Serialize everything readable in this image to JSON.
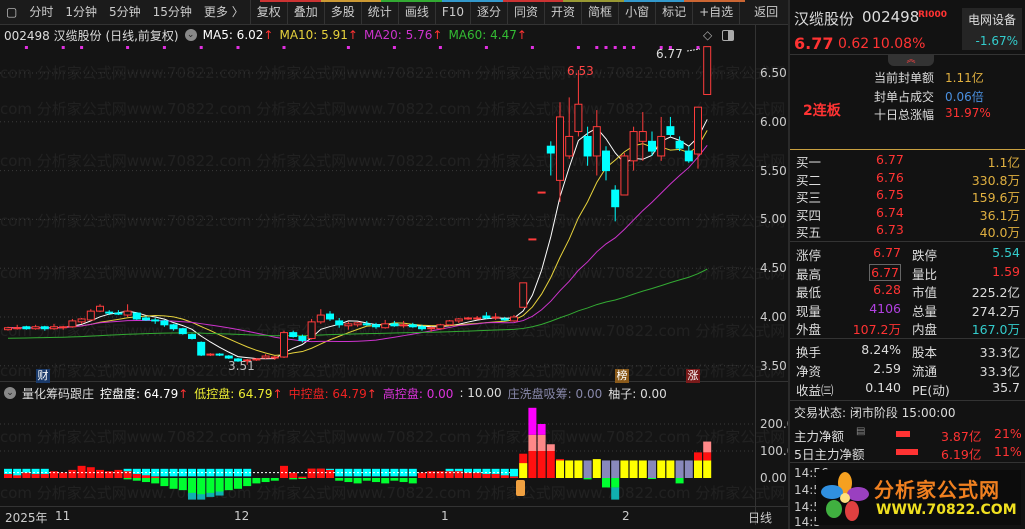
{
  "toolbar": {
    "items": [
      "分时",
      "1分钟",
      "5分钟",
      "15分钟",
      "更多 〉"
    ],
    "buttons": [
      "复权",
      "叠加",
      "多股",
      "统计",
      "画线",
      "F10",
      "逐分",
      "同资",
      "开资",
      "简框",
      "小窗",
      "标记",
      "+自选",
      "返回"
    ]
  },
  "info": {
    "title": "002498 汉缆股份 (日线,前复权)",
    "ma5": "MA5: 6.02",
    "ma10": "MA10: 5.91",
    "ma20": "MA20: 5.76",
    "ma60": "MA60: 4.47",
    "arrow": "↑"
  },
  "colors": {
    "up": "#ff3c3c",
    "down": "#00ffff",
    "ma5": "#ffffff",
    "ma10": "#e6d23c",
    "ma20": "#cc33cc",
    "ma60": "#33aa33"
  },
  "price_axis": [
    "6.50",
    "6.00",
    "5.50",
    "5.00",
    "4.50",
    "4.00",
    "3.50"
  ],
  "ind_axis": [
    "200.0",
    "100.0",
    "0.00"
  ],
  "annotations": {
    "high": "6.53",
    "last": "6.77",
    "low": "3.51",
    "cai": "财",
    "bang": "榜",
    "zhang": "涨"
  },
  "indicator": {
    "name": "量化筹码跟庄",
    "kpd": "控盘度: 64.79",
    "dkp": "低控盘: 64.79",
    "zkp": "中控盘: 64.79",
    "gkp": "高控盘: 0.00",
    "ten": ": 10.00",
    "zx": "庄洗盘吸筹: 0.00",
    "yz": "柚子: 0.00",
    "arrow": "↑"
  },
  "xaxis": {
    "year": "2025年",
    "m11": "11",
    "m12": "12",
    "m1": "1",
    "m2": "2",
    "period": "日线"
  },
  "watermark": "com 分析家公式网www.70822.com 分析家公式网www.70822.com 分析家公式网www.70822.com 分析家公式网",
  "chart_data": {
    "type": "candlestick",
    "ylim": [
      3.5,
      6.77
    ],
    "ohlc": [
      [
        3.87,
        3.9,
        3.86,
        3.89
      ],
      [
        3.88,
        3.92,
        3.87,
        3.89
      ],
      [
        3.9,
        3.91,
        3.87,
        3.88
      ],
      [
        3.88,
        3.92,
        3.87,
        3.9
      ],
      [
        3.9,
        3.91,
        3.86,
        3.88
      ],
      [
        3.88,
        3.93,
        3.87,
        3.9
      ],
      [
        3.89,
        3.91,
        3.87,
        3.9
      ],
      [
        3.9,
        3.98,
        3.89,
        3.96
      ],
      [
        3.95,
        3.99,
        3.93,
        3.98
      ],
      [
        3.97,
        4.08,
        3.96,
        4.06
      ],
      [
        4.06,
        4.13,
        4.05,
        4.11
      ],
      [
        4.05,
        4.07,
        4.02,
        4.04
      ],
      [
        4.04,
        4.07,
        4.02,
        4.03
      ],
      [
        4.02,
        4.13,
        4.0,
        4.06
      ],
      [
        4.04,
        4.05,
        3.97,
        3.98
      ],
      [
        3.99,
        4.01,
        3.96,
        3.97
      ],
      [
        3.97,
        3.99,
        3.93,
        3.96
      ],
      [
        3.96,
        3.97,
        3.9,
        3.92
      ],
      [
        3.92,
        3.93,
        3.86,
        3.88
      ],
      [
        3.88,
        3.89,
        3.82,
        3.83
      ],
      [
        3.82,
        3.83,
        3.77,
        3.78
      ],
      [
        3.74,
        3.75,
        3.6,
        3.61
      ],
      [
        3.61,
        3.63,
        3.6,
        3.62
      ],
      [
        3.62,
        3.63,
        3.6,
        3.61
      ],
      [
        3.6,
        3.61,
        3.57,
        3.58
      ],
      [
        3.57,
        3.58,
        3.54,
        3.55
      ],
      [
        3.55,
        3.57,
        3.51,
        3.56
      ],
      [
        3.56,
        3.58,
        3.55,
        3.57
      ],
      [
        3.58,
        3.62,
        3.57,
        3.6
      ],
      [
        3.58,
        3.6,
        3.56,
        3.59
      ],
      [
        3.59,
        3.86,
        3.58,
        3.84
      ],
      [
        3.84,
        3.86,
        3.79,
        3.8
      ],
      [
        3.8,
        3.82,
        3.74,
        3.76
      ],
      [
        3.78,
        3.98,
        3.77,
        3.95
      ],
      [
        3.95,
        4.08,
        3.93,
        4.02
      ],
      [
        4.03,
        4.06,
        3.96,
        3.98
      ],
      [
        3.96,
        3.99,
        3.89,
        3.92
      ],
      [
        3.91,
        3.95,
        3.87,
        3.93
      ],
      [
        3.92,
        3.95,
        3.9,
        3.94
      ],
      [
        3.93,
        3.96,
        3.91,
        3.92
      ],
      [
        3.92,
        3.94,
        3.88,
        3.9
      ],
      [
        3.89,
        3.97,
        3.88,
        3.93
      ],
      [
        3.93,
        3.96,
        3.9,
        3.91
      ],
      [
        3.91,
        3.96,
        3.89,
        3.92
      ],
      [
        3.92,
        3.94,
        3.89,
        3.9
      ],
      [
        3.9,
        3.92,
        3.86,
        3.88
      ],
      [
        3.88,
        3.9,
        3.85,
        3.89
      ],
      [
        3.88,
        3.93,
        3.87,
        3.92
      ],
      [
        3.92,
        3.97,
        3.91,
        3.96
      ],
      [
        3.96,
        3.99,
        3.94,
        3.98
      ],
      [
        3.98,
        4.0,
        3.97,
        3.99
      ],
      [
        3.99,
        4.01,
        3.98,
        3.99
      ],
      [
        4.01,
        4.05,
        3.98,
        3.99
      ],
      [
        3.99,
        4.04,
        3.97,
        4.0
      ],
      [
        3.98,
        4.0,
        3.96,
        3.97
      ],
      [
        3.96,
        4.02,
        3.95,
        4.0
      ],
      [
        4.1,
        4.35,
        4.1,
        4.35
      ],
      [
        4.8,
        4.8,
        4.8,
        4.8
      ],
      [
        5.28,
        5.28,
        5.28,
        5.28
      ],
      [
        5.75,
        5.8,
        5.45,
        5.68
      ],
      [
        5.4,
        6.2,
        5.18,
        6.05
      ],
      [
        5.65,
        6.25,
        5.62,
        5.85
      ],
      [
        5.9,
        6.53,
        5.85,
        6.18
      ],
      [
        5.85,
        5.95,
        5.55,
        5.65
      ],
      [
        5.65,
        6.12,
        5.45,
        5.95
      ],
      [
        5.7,
        5.75,
        5.4,
        5.5
      ],
      [
        5.3,
        5.35,
        4.98,
        5.13
      ],
      [
        5.25,
        5.68,
        5.25,
        5.65
      ],
      [
        5.6,
        5.95,
        5.5,
        5.9
      ],
      [
        5.8,
        6.1,
        5.6,
        5.9
      ],
      [
        5.8,
        5.9,
        5.65,
        5.7
      ],
      [
        5.65,
        6.05,
        5.6,
        5.85
      ],
      [
        5.95,
        6.05,
        5.85,
        5.87
      ],
      [
        5.8,
        5.85,
        5.7,
        5.73
      ],
      [
        5.7,
        5.75,
        5.58,
        5.6
      ],
      [
        5.67,
        6.15,
        5.52,
        6.15
      ],
      [
        6.28,
        6.77,
        6.28,
        6.77
      ]
    ],
    "top_markers": [
      2,
      6,
      8,
      13,
      17,
      21,
      25,
      30,
      37,
      42,
      47,
      52,
      57,
      62,
      64,
      65,
      66,
      67,
      68,
      71,
      72,
      75
    ],
    "indicator_red": [
      15,
      10,
      20,
      15,
      15,
      25,
      20,
      30,
      45,
      40,
      30,
      25,
      30,
      25,
      15,
      10,
      5,
      0,
      0,
      0,
      0,
      0,
      0,
      0,
      0,
      0,
      0,
      0,
      0,
      0,
      45,
      20,
      5,
      35,
      35,
      30,
      0,
      0,
      0,
      0,
      0,
      0,
      0,
      0,
      0,
      20,
      25,
      25,
      25,
      25,
      20,
      20,
      15,
      15,
      10,
      5
    ],
    "indicator_cyan": [
      1,
      1,
      1,
      1,
      1,
      0,
      0,
      0,
      0,
      0,
      0,
      0,
      0,
      1,
      1,
      1,
      1,
      1,
      1,
      1,
      1,
      1,
      1,
      1,
      1,
      1,
      1,
      0,
      0,
      0,
      0,
      0,
      0,
      0,
      1,
      1,
      1,
      1,
      1,
      1,
      1,
      1,
      1,
      1,
      1,
      0,
      0,
      0,
      1,
      1,
      1,
      1,
      1,
      1,
      1,
      1
    ],
    "indicator_green": [
      0,
      0,
      0,
      0,
      0,
      0,
      0,
      0,
      0,
      0,
      0,
      0,
      0,
      -5,
      -10,
      -15,
      -20,
      -30,
      -40,
      -45,
      -55,
      -60,
      -55,
      -50,
      -45,
      -40,
      -30,
      -20,
      -15,
      -10,
      0,
      -5,
      -3,
      0,
      0,
      0,
      -10,
      -15,
      -20,
      -10,
      -15,
      -20,
      -10,
      -15,
      -20,
      0,
      0,
      0,
      0,
      0,
      0,
      0,
      0,
      0,
      0,
      0
    ],
    "indicator_teal": [
      0,
      0,
      0,
      0,
      0,
      0,
      0,
      0,
      0,
      0,
      0,
      0,
      0,
      0,
      0,
      0,
      0,
      0,
      0,
      0,
      -80,
      -80,
      -70,
      -65,
      0,
      0,
      0,
      0,
      0,
      0,
      0,
      0,
      0,
      0,
      0,
      0,
      0,
      0,
      0,
      0,
      0,
      0,
      0,
      0,
      0,
      0,
      0,
      0,
      0,
      0,
      0,
      0,
      0,
      0,
      0,
      0
    ],
    "indicator_tail": [
      [
        [
          "r",
          0,
          90
        ],
        [
          "y",
          0,
          55
        ]
      ],
      [
        [
          "r",
          0,
          100
        ],
        [
          "p",
          100,
          160
        ],
        [
          "m",
          160,
          260
        ]
      ],
      [
        [
          "r",
          0,
          100
        ],
        [
          "p",
          100,
          160
        ],
        [
          "m",
          160,
          200
        ]
      ],
      [
        [
          "r",
          0,
          100
        ],
        [
          "p",
          100,
          125
        ]
      ],
      [
        [
          "r",
          0,
          70
        ],
        [
          "y",
          0,
          65
        ]
      ],
      [
        [
          "y",
          0,
          65
        ]
      ],
      [
        [
          "y",
          0,
          65
        ]
      ],
      [
        [
          "v",
          0,
          65
        ],
        [
          "g",
          0,
          -5
        ]
      ],
      [
        [
          "y",
          0,
          70
        ]
      ],
      [
        [
          "v",
          0,
          65
        ],
        [
          "g",
          0,
          -35
        ]
      ],
      [
        [
          "v",
          0,
          65
        ],
        [
          "g",
          0,
          -35
        ],
        [
          "t",
          -35,
          -80
        ]
      ],
      [
        [
          "y",
          0,
          65
        ]
      ],
      [
        [
          "y",
          0,
          65
        ]
      ],
      [
        [
          "y",
          0,
          65
        ]
      ],
      [
        [
          "v",
          0,
          65
        ],
        [
          "g",
          0,
          -3
        ]
      ],
      [
        [
          "y",
          0,
          65
        ]
      ],
      [
        [
          "y",
          0,
          65
        ]
      ],
      [
        [
          "v",
          0,
          65
        ],
        [
          "g",
          0,
          -20
        ]
      ],
      [
        [
          "v",
          0,
          65
        ]
      ],
      [
        [
          "y",
          0,
          65
        ],
        [
          "r",
          65,
          95
        ]
      ],
      [
        [
          "y",
          0,
          65
        ],
        [
          "r",
          65,
          95
        ],
        [
          "p",
          95,
          135
        ]
      ]
    ]
  },
  "quote": {
    "name": "汉缆股份",
    "code": "002498",
    "tag": "RI000",
    "price": "6.77",
    "change": "0.62",
    "pct": "10.08%",
    "sector": "电网设备",
    "sector_pct": "-1.67%",
    "board": "2连板",
    "seal_label": "当前封单额",
    "seal": "1.11亿",
    "ratio_label": "封单占成交",
    "ratio": "0.06倍",
    "ten_label": "十日总涨幅",
    "ten": "31.97%",
    "book": [
      [
        "买一",
        "6.77",
        "1.1亿"
      ],
      [
        "买二",
        "6.76",
        "330.8万"
      ],
      [
        "买三",
        "6.75",
        "159.6万"
      ],
      [
        "买四",
        "6.74",
        "36.1万"
      ],
      [
        "买五",
        "6.73",
        "40.0万"
      ]
    ],
    "stats": [
      [
        "涨停",
        "6.77",
        "跌停",
        "5.54"
      ],
      [
        "最高",
        "6.77",
        "量比",
        "1.59"
      ],
      [
        "最低",
        "6.28",
        "市值",
        "225.2亿"
      ],
      [
        "现量",
        "4106",
        "总量",
        "274.2万"
      ],
      [
        "外盘",
        "107.2万",
        "内盘",
        "167.0万"
      ]
    ],
    "fund": [
      [
        "换手",
        "8.24%",
        "股本",
        "33.3亿"
      ],
      [
        "净资",
        "2.59",
        "流通",
        "33.3亿"
      ],
      [
        "收益㈢",
        "0.140",
        "PE(动)",
        "35.7"
      ]
    ],
    "status": "交易状态: 闭市阶段 15:00:00",
    "main_net_label": "主力净额",
    "main_net": "3.87亿",
    "main_net_pct": "21%",
    "main5_label": "5日主力净额",
    "main5": "6.19亿",
    "main5_pct": "11%",
    "ticks": [
      "14:56",
      "14:5",
      "14:5",
      "14:5"
    ]
  },
  "logo": {
    "title": "分析家公式网",
    "url": "WWW.70822.COM"
  }
}
